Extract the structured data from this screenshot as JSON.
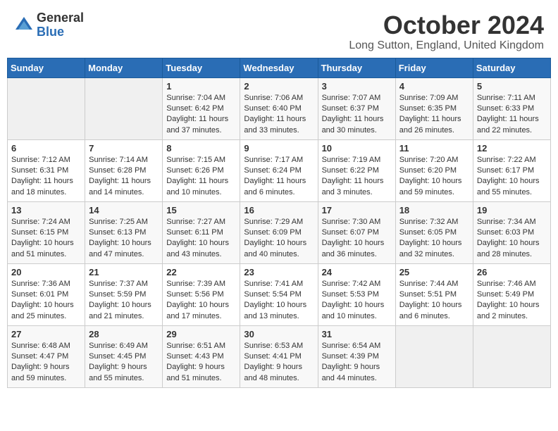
{
  "header": {
    "logo_general": "General",
    "logo_blue": "Blue",
    "month_title": "October 2024",
    "location": "Long Sutton, England, United Kingdom"
  },
  "weekdays": [
    "Sunday",
    "Monday",
    "Tuesday",
    "Wednesday",
    "Thursday",
    "Friday",
    "Saturday"
  ],
  "weeks": [
    [
      {
        "day": "",
        "info": ""
      },
      {
        "day": "",
        "info": ""
      },
      {
        "day": "1",
        "info": "Sunrise: 7:04 AM\nSunset: 6:42 PM\nDaylight: 11 hours and 37 minutes."
      },
      {
        "day": "2",
        "info": "Sunrise: 7:06 AM\nSunset: 6:40 PM\nDaylight: 11 hours and 33 minutes."
      },
      {
        "day": "3",
        "info": "Sunrise: 7:07 AM\nSunset: 6:37 PM\nDaylight: 11 hours and 30 minutes."
      },
      {
        "day": "4",
        "info": "Sunrise: 7:09 AM\nSunset: 6:35 PM\nDaylight: 11 hours and 26 minutes."
      },
      {
        "day": "5",
        "info": "Sunrise: 7:11 AM\nSunset: 6:33 PM\nDaylight: 11 hours and 22 minutes."
      }
    ],
    [
      {
        "day": "6",
        "info": "Sunrise: 7:12 AM\nSunset: 6:31 PM\nDaylight: 11 hours and 18 minutes."
      },
      {
        "day": "7",
        "info": "Sunrise: 7:14 AM\nSunset: 6:28 PM\nDaylight: 11 hours and 14 minutes."
      },
      {
        "day": "8",
        "info": "Sunrise: 7:15 AM\nSunset: 6:26 PM\nDaylight: 11 hours and 10 minutes."
      },
      {
        "day": "9",
        "info": "Sunrise: 7:17 AM\nSunset: 6:24 PM\nDaylight: 11 hours and 6 minutes."
      },
      {
        "day": "10",
        "info": "Sunrise: 7:19 AM\nSunset: 6:22 PM\nDaylight: 11 hours and 3 minutes."
      },
      {
        "day": "11",
        "info": "Sunrise: 7:20 AM\nSunset: 6:20 PM\nDaylight: 10 hours and 59 minutes."
      },
      {
        "day": "12",
        "info": "Sunrise: 7:22 AM\nSunset: 6:17 PM\nDaylight: 10 hours and 55 minutes."
      }
    ],
    [
      {
        "day": "13",
        "info": "Sunrise: 7:24 AM\nSunset: 6:15 PM\nDaylight: 10 hours and 51 minutes."
      },
      {
        "day": "14",
        "info": "Sunrise: 7:25 AM\nSunset: 6:13 PM\nDaylight: 10 hours and 47 minutes."
      },
      {
        "day": "15",
        "info": "Sunrise: 7:27 AM\nSunset: 6:11 PM\nDaylight: 10 hours and 43 minutes."
      },
      {
        "day": "16",
        "info": "Sunrise: 7:29 AM\nSunset: 6:09 PM\nDaylight: 10 hours and 40 minutes."
      },
      {
        "day": "17",
        "info": "Sunrise: 7:30 AM\nSunset: 6:07 PM\nDaylight: 10 hours and 36 minutes."
      },
      {
        "day": "18",
        "info": "Sunrise: 7:32 AM\nSunset: 6:05 PM\nDaylight: 10 hours and 32 minutes."
      },
      {
        "day": "19",
        "info": "Sunrise: 7:34 AM\nSunset: 6:03 PM\nDaylight: 10 hours and 28 minutes."
      }
    ],
    [
      {
        "day": "20",
        "info": "Sunrise: 7:36 AM\nSunset: 6:01 PM\nDaylight: 10 hours and 25 minutes."
      },
      {
        "day": "21",
        "info": "Sunrise: 7:37 AM\nSunset: 5:59 PM\nDaylight: 10 hours and 21 minutes."
      },
      {
        "day": "22",
        "info": "Sunrise: 7:39 AM\nSunset: 5:56 PM\nDaylight: 10 hours and 17 minutes."
      },
      {
        "day": "23",
        "info": "Sunrise: 7:41 AM\nSunset: 5:54 PM\nDaylight: 10 hours and 13 minutes."
      },
      {
        "day": "24",
        "info": "Sunrise: 7:42 AM\nSunset: 5:53 PM\nDaylight: 10 hours and 10 minutes."
      },
      {
        "day": "25",
        "info": "Sunrise: 7:44 AM\nSunset: 5:51 PM\nDaylight: 10 hours and 6 minutes."
      },
      {
        "day": "26",
        "info": "Sunrise: 7:46 AM\nSunset: 5:49 PM\nDaylight: 10 hours and 2 minutes."
      }
    ],
    [
      {
        "day": "27",
        "info": "Sunrise: 6:48 AM\nSunset: 4:47 PM\nDaylight: 9 hours and 59 minutes."
      },
      {
        "day": "28",
        "info": "Sunrise: 6:49 AM\nSunset: 4:45 PM\nDaylight: 9 hours and 55 minutes."
      },
      {
        "day": "29",
        "info": "Sunrise: 6:51 AM\nSunset: 4:43 PM\nDaylight: 9 hours and 51 minutes."
      },
      {
        "day": "30",
        "info": "Sunrise: 6:53 AM\nSunset: 4:41 PM\nDaylight: 9 hours and 48 minutes."
      },
      {
        "day": "31",
        "info": "Sunrise: 6:54 AM\nSunset: 4:39 PM\nDaylight: 9 hours and 44 minutes."
      },
      {
        "day": "",
        "info": ""
      },
      {
        "day": "",
        "info": ""
      }
    ]
  ]
}
